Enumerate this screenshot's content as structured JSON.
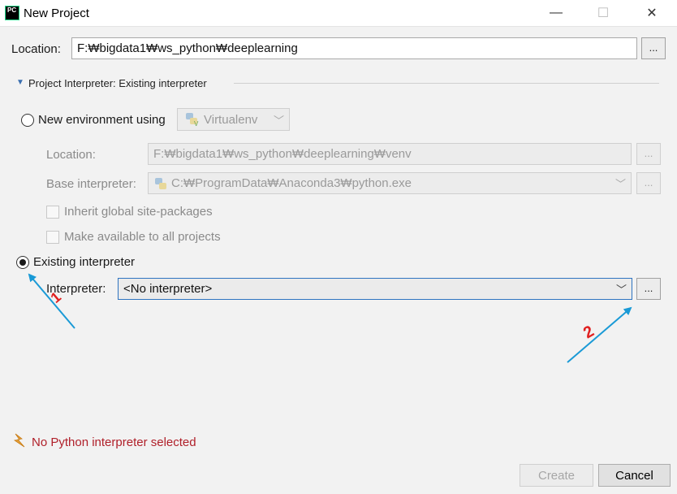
{
  "window": {
    "title": "New Project",
    "app_icon_text": "PC",
    "minimize": "—",
    "maximize": "☐",
    "close": "✕"
  },
  "location": {
    "label": "Location:",
    "value": "F:₩bigdata1₩ws_python₩deeplearning",
    "browse": "..."
  },
  "interpreter_section": {
    "header": "Project Interpreter: Existing interpreter",
    "new_env": {
      "label": "New environment using",
      "selected": false,
      "tool": "Virtualenv",
      "location_label": "Location:",
      "location_value": "F:₩bigdata1₩ws_python₩deeplearning₩venv",
      "base_label": "Base interpreter:",
      "base_value": "C:₩ProgramData₩Anaconda3₩python.exe",
      "browse": "...",
      "inherit_label": "Inherit global site-packages",
      "make_available_label": "Make available to all projects"
    },
    "existing": {
      "label": "Existing interpreter",
      "selected": true,
      "interpreter_label": "Interpreter:",
      "interpreter_value": "<No interpreter>",
      "browse": "..."
    }
  },
  "annotations": {
    "marker1": "1",
    "marker2": "2",
    "arrow_color": "#1a9ad6",
    "number_color": "#e02020"
  },
  "warning": {
    "text": "No Python interpreter selected",
    "color": "#b0202a"
  },
  "buttons": {
    "create": "Create",
    "cancel": "Cancel"
  }
}
